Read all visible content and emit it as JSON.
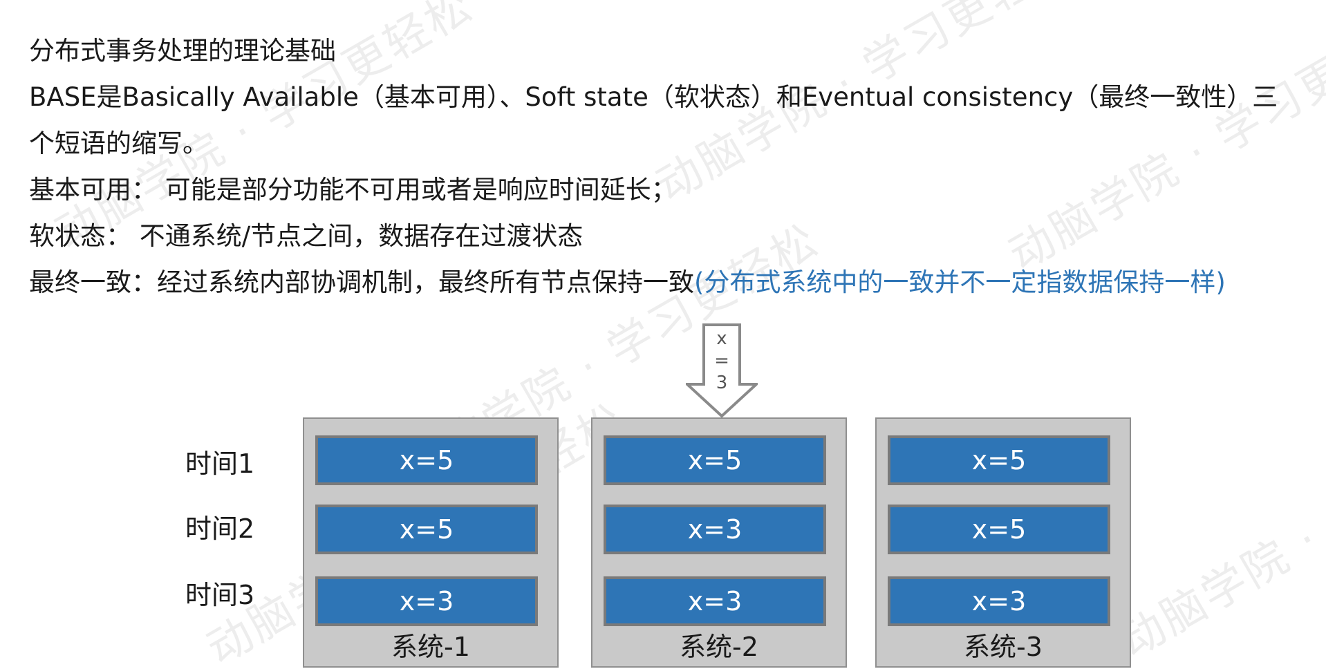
{
  "text": {
    "title": "分布式事务处理的理论基础",
    "base_line_1": "BASE是Basically Available（基本可用）、Soft state（软状态）和Eventual consistency（最终一致性）三",
    "base_line_2": "个短语的缩写。",
    "basic_available": "基本可用： 可能是部分功能不可用或者是响应时间延长；",
    "soft_state": "软状态： 不通系统/节点之间，数据存在过渡状态",
    "eventual_prefix": "最终一致：经过系统内部协调机制，最终所有节点保持一致",
    "eventual_note": "(分布式系统中的一致并不一定指数据保持一样)"
  },
  "watermark": "动脑学院 · 学习更轻松",
  "diagram": {
    "arrow_label": [
      "x",
      "=",
      "3"
    ],
    "time_labels": [
      "时间1",
      "时间2",
      "时间3"
    ],
    "systems": [
      {
        "name": "系统-1",
        "cells": [
          "x=5",
          "x=5",
          "x=3"
        ]
      },
      {
        "name": "系统-2",
        "cells": [
          "x=5",
          "x=3",
          "x=3"
        ]
      },
      {
        "name": "系统-3",
        "cells": [
          "x=5",
          "x=5",
          "x=3"
        ]
      }
    ]
  },
  "colors": {
    "highlight_text": "#2e75b6",
    "cell_fill": "#2e75b6",
    "cell_border": "#7a7a7a",
    "system_fill": "#c9c9c9",
    "arrow_stroke": "#8a8a8a"
  }
}
